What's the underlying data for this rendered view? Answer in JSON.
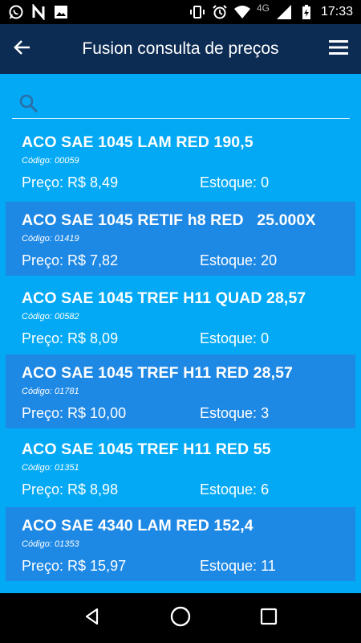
{
  "status_bar": {
    "time": "17:33",
    "network": "4G",
    "icons": [
      "whatsapp-icon",
      "n-app-icon",
      "image-icon",
      "vibrate-icon",
      "alarm-icon",
      "wifi-icon",
      "signal-icon",
      "battery-charging-icon"
    ]
  },
  "app_bar": {
    "title": "Fusion consulta de preços",
    "back_icon": "arrow-left-icon",
    "menu_icon": "hamburger-menu-icon"
  },
  "search": {
    "placeholder": "",
    "value": ""
  },
  "labels": {
    "code_prefix": "Código: ",
    "price_prefix": "Preço: R$ ",
    "stock_prefix": "Estoque: "
  },
  "products": [
    {
      "name": "ACO SAE 1045 LAM RED 190,5",
      "code": "00059",
      "price": "8,49",
      "stock": "0"
    },
    {
      "name": "ACO SAE 1045 RETIF h8 RED   25.000X",
      "code": "01419",
      "price": "7,82",
      "stock": "20"
    },
    {
      "name": "ACO SAE 1045 TREF H11 QUAD 28,57",
      "code": "00582",
      "price": "8,09",
      "stock": "0"
    },
    {
      "name": "ACO SAE 1045 TREF H11 RED 28,57",
      "code": "01781",
      "price": "10,00",
      "stock": "3"
    },
    {
      "name": "ACO SAE 1045 TREF H11 RED 55",
      "code": "01351",
      "price": "8,98",
      "stock": "6"
    },
    {
      "name": "ACO SAE 4340 LAM RED 152,4",
      "code": "01353",
      "price": "15,97",
      "stock": "11"
    }
  ],
  "colors": {
    "background": "#03A9F4",
    "app_bar": "#0D2C54",
    "alt_row": "#1E88E5"
  }
}
